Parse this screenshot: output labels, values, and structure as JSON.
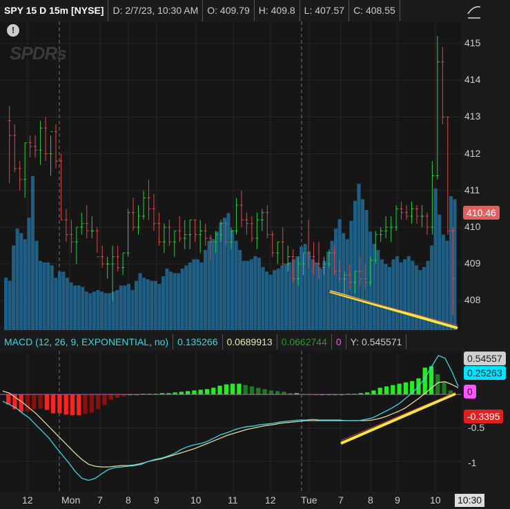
{
  "header": {
    "symbol": "SPY 15 D 15m [NYSE]",
    "date": "D: 2/7/23, 10:30 AM",
    "open": "O: 409.79",
    "high": "H: 409.8",
    "low": "L: 407.57",
    "close": "C: 408.55"
  },
  "watermark": "SPDRs",
  "price_axis": {
    "ticks": [
      "415",
      "414",
      "413",
      "412",
      "411",
      "410",
      "409",
      "408"
    ],
    "current_price": "410.46"
  },
  "macd": {
    "study": "MACD (12, 26, 9, EXPONENTIAL, no)",
    "value": "0.135266",
    "avg": "0.0689913",
    "diff": "0.0662744",
    "zeroline": "0",
    "cursor": "Y: 0.545571",
    "axis_ticks": [
      "-0.5",
      "-1"
    ],
    "label_max": "0.54557",
    "label_value": "0.25263",
    "label_zero": "0",
    "label_min": "-0.3395"
  },
  "time_axis": {
    "labels": [
      "12",
      "Mon",
      "7",
      "8",
      "9",
      "10",
      "11",
      "12",
      "Tue",
      "7",
      "8",
      "9",
      "10"
    ],
    "cursor_time": "10:30"
  },
  "colors": {
    "up_candle": "#2ecc40",
    "down_candle": "#e04848",
    "volume": "#1f5f86",
    "macd_line": "#3fd6e6",
    "avg_line": "#e8d8a0",
    "hist_pos_strong": "#22ee22",
    "hist_pos_weak": "#1e7a1e",
    "hist_neg_strong": "#ff2020",
    "hist_neg_weak": "#8a1010",
    "trendline": "#f5e642",
    "price_label_bg": "#e06060",
    "macd_label_bg": "#00e5ff",
    "max_label_bg": "#d0d0d0",
    "zero_label_bg": "#ff55ff",
    "min_label_bg": "#e02020"
  },
  "chart_data": {
    "type": "candlestick",
    "candles": [
      [
        412.9,
        413.3,
        411.2,
        412.5
      ],
      [
        412.5,
        412.8,
        411.5,
        411.6
      ],
      [
        411.6,
        411.8,
        411.0,
        411.3
      ],
      [
        411.3,
        412.3,
        410.8,
        412.3
      ],
      [
        412.3,
        412.5,
        411.9,
        412.2
      ],
      [
        412.2,
        412.5,
        411.9,
        412.1
      ],
      [
        412.1,
        412.9,
        411.7,
        412.7
      ],
      [
        412.7,
        413.0,
        411.8,
        412.0
      ],
      [
        412.0,
        412.5,
        411.4,
        412.6
      ],
      [
        412.6,
        412.8,
        411.6,
        411.8
      ],
      [
        411.8,
        412.0,
        410.2,
        410.2
      ],
      [
        410.2,
        410.5,
        409.6,
        409.8
      ],
      [
        409.8,
        410.2,
        409.3,
        409.6
      ],
      [
        409.6,
        410.0,
        409.0,
        410.0
      ],
      [
        410.0,
        410.4,
        409.8,
        410.1
      ],
      [
        410.1,
        410.6,
        409.7,
        409.9
      ],
      [
        409.9,
        410.3,
        409.7,
        409.9
      ],
      [
        409.9,
        410.0,
        409.3,
        409.2
      ],
      [
        409.2,
        409.5,
        408.9,
        409.0
      ],
      [
        409.0,
        409.2,
        408.6,
        409.0
      ],
      [
        409.0,
        409.5,
        408.0,
        409.2
      ],
      [
        409.2,
        409.5,
        408.8,
        408.9
      ],
      [
        408.9,
        409.3,
        408.7,
        409.3
      ],
      [
        409.3,
        410.5,
        409.2,
        410.4
      ],
      [
        410.4,
        410.8,
        409.9,
        410.0
      ],
      [
        410.0,
        410.6,
        409.8,
        410.3
      ],
      [
        410.3,
        411.0,
        410.2,
        410.8
      ],
      [
        410.8,
        411.3,
        410.2,
        410.5
      ],
      [
        410.5,
        410.9,
        409.9,
        410.1
      ],
      [
        410.1,
        410.4,
        409.5,
        409.6
      ],
      [
        409.6,
        410.1,
        409.3,
        410.0
      ],
      [
        410.0,
        410.2,
        409.5,
        409.6
      ],
      [
        409.6,
        409.9,
        409.2,
        409.9
      ],
      [
        409.9,
        410.3,
        409.6,
        409.7
      ],
      [
        409.7,
        410.2,
        409.4,
        409.8
      ],
      [
        409.8,
        410.2,
        409.4,
        410.2
      ],
      [
        410.2,
        410.2,
        409.6,
        409.8
      ],
      [
        409.8,
        410.2,
        409.3,
        409.9
      ],
      [
        409.9,
        410.1,
        409.5,
        409.7
      ],
      [
        409.7,
        409.8,
        409.1,
        409.6
      ],
      [
        409.6,
        409.9,
        409.3,
        409.8
      ],
      [
        409.8,
        410.2,
        409.6,
        410.1
      ],
      [
        410.1,
        410.2,
        409.5,
        409.6
      ],
      [
        409.6,
        410.0,
        409.4,
        409.9
      ],
      [
        409.9,
        410.8,
        409.8,
        410.6
      ],
      [
        410.6,
        411.0,
        410.0,
        410.2
      ],
      [
        410.2,
        410.4,
        409.8,
        410.1
      ],
      [
        410.1,
        410.3,
        409.6,
        409.7
      ],
      [
        409.7,
        410.4,
        409.4,
        410.2
      ],
      [
        410.2,
        410.5,
        409.9,
        410.4
      ],
      [
        410.4,
        410.6,
        409.7,
        409.8
      ],
      [
        409.8,
        409.9,
        409.2,
        409.3
      ],
      [
        409.3,
        409.6,
        409.0,
        409.6
      ],
      [
        409.6,
        410.0,
        408.9,
        409.0
      ],
      [
        409.0,
        409.5,
        408.8,
        409.2
      ],
      [
        409.2,
        409.4,
        408.5,
        408.6
      ],
      [
        408.6,
        409.2,
        408.4,
        409.0
      ],
      [
        409.0,
        409.3,
        408.7,
        409.3
      ],
      [
        409.3,
        410.2,
        408.9,
        409.2
      ],
      [
        409.2,
        409.6,
        408.7,
        409.0
      ],
      [
        409.0,
        409.6,
        408.6,
        408.9
      ],
      [
        408.9,
        409.2,
        408.7,
        409.0
      ],
      [
        409.0,
        409.4,
        408.9,
        409.3
      ],
      [
        409.3,
        409.5,
        408.7,
        408.8
      ],
      [
        408.8,
        409.1,
        408.5,
        408.6
      ],
      [
        408.6,
        408.8,
        408.1,
        408.7
      ],
      [
        408.7,
        409.0,
        408.3,
        408.5
      ],
      [
        408.5,
        408.8,
        408.2,
        408.8
      ],
      [
        408.8,
        409.2,
        408.4,
        408.6
      ],
      [
        408.6,
        409.0,
        408.3,
        408.5
      ],
      [
        408.5,
        409.2,
        408.4,
        409.1
      ],
      [
        409.1,
        409.9,
        409.0,
        409.8
      ],
      [
        409.8,
        410.0,
        409.6,
        409.9
      ],
      [
        409.9,
        410.3,
        409.7,
        410.0
      ],
      [
        410.0,
        410.3,
        409.6,
        410.0
      ],
      [
        410.0,
        410.6,
        409.9,
        410.5
      ],
      [
        410.5,
        410.7,
        410.2,
        410.4
      ],
      [
        410.4,
        410.6,
        410.2,
        410.3
      ],
      [
        410.3,
        410.7,
        410.1,
        410.5
      ],
      [
        410.5,
        410.6,
        410.1,
        410.3
      ],
      [
        410.3,
        410.6,
        410.0,
        410.3
      ],
      [
        410.3,
        410.4,
        409.8,
        410.0
      ],
      [
        410.0,
        411.8,
        409.8,
        411.4
      ],
      [
        411.4,
        415.2,
        411.3,
        414.5
      ],
      [
        414.5,
        414.9,
        412.8,
        413.0
      ],
      [
        413.0,
        413.0,
        409.8,
        409.9
      ],
      [
        409.9,
        410.0,
        407.6,
        408.6
      ]
    ],
    "volume": [
      0.34,
      0.32,
      0.55,
      0.66,
      0.63,
      0.59,
      0.73,
      1.0,
      0.58,
      0.45,
      0.44,
      0.44,
      0.42,
      0.34,
      0.38,
      0.38,
      0.34,
      0.31,
      0.29,
      0.29,
      0.28,
      0.25,
      0.24,
      0.25,
      0.26,
      0.25,
      0.24,
      0.24,
      0.25,
      0.26,
      0.29,
      0.29,
      0.3,
      0.26,
      0.32,
      0.37,
      0.34,
      0.33,
      0.32,
      0.32,
      0.3,
      0.35,
      0.4,
      0.38,
      0.37,
      0.37,
      0.4,
      0.42,
      0.44,
      0.46,
      0.46,
      0.44,
      0.52,
      0.58,
      0.59,
      0.64,
      0.7,
      0.73,
      0.76,
      0.65,
      0.58,
      0.52,
      0.45,
      0.45,
      0.46,
      0.48,
      0.47,
      0.41,
      0.38,
      0.36,
      0.39,
      0.4,
      0.42,
      0.43,
      0.44,
      0.46,
      0.48,
      0.54,
      0.56,
      0.51,
      0.46,
      0.44,
      0.4,
      0.45,
      0.51,
      0.58,
      0.66,
      0.72,
      0.63,
      0.59,
      0.71,
      0.84,
      0.95,
      0.85,
      0.78,
      0.64,
      0.56,
      0.52,
      0.46,
      0.43,
      0.41,
      0.46,
      0.48,
      0.44,
      0.46,
      0.48,
      0.45,
      0.42,
      0.39,
      0.41,
      0.45,
      0.55,
      0.92,
      0.75,
      0.62,
      0.58,
      0.87,
      0.85
    ],
    "macd_line": [
      -0.1,
      -0.15,
      -0.2,
      -0.28,
      -0.35,
      -0.45,
      -0.55,
      -0.65,
      -0.78,
      -0.9,
      -1.02,
      -1.15,
      -1.25,
      -1.28,
      -1.25,
      -1.18,
      -1.12,
      -1.09,
      -1.08,
      -1.07,
      -1.06,
      -1.04,
      -1.0,
      -0.97,
      -0.95,
      -0.92,
      -0.88,
      -0.82,
      -0.78,
      -0.75,
      -0.73,
      -0.7,
      -0.65,
      -0.6,
      -0.57,
      -0.53,
      -0.5,
      -0.48,
      -0.47,
      -0.45,
      -0.44,
      -0.43,
      -0.41,
      -0.4,
      -0.39,
      -0.38,
      -0.38,
      -0.37,
      -0.38,
      -0.38,
      -0.38,
      -0.38,
      -0.39,
      -0.39,
      -0.39,
      -0.37,
      -0.35,
      -0.3,
      -0.25,
      -0.2,
      -0.14,
      -0.06,
      0.02,
      0.12,
      0.25,
      0.42,
      0.58,
      0.54,
      0.35,
      0.12
    ],
    "avg_line": [
      0.05,
      0.02,
      -0.05,
      -0.12,
      -0.2,
      -0.28,
      -0.38,
      -0.48,
      -0.58,
      -0.68,
      -0.78,
      -0.88,
      -0.97,
      -1.04,
      -1.07,
      -1.08,
      -1.08,
      -1.07,
      -1.06,
      -1.06,
      -1.05,
      -1.03,
      -1.0,
      -0.98,
      -0.96,
      -0.93,
      -0.9,
      -0.87,
      -0.84,
      -0.81,
      -0.77,
      -0.73,
      -0.69,
      -0.65,
      -0.61,
      -0.58,
      -0.55,
      -0.52,
      -0.5,
      -0.48,
      -0.46,
      -0.45,
      -0.43,
      -0.42,
      -0.41,
      -0.4,
      -0.39,
      -0.39,
      -0.39,
      -0.39,
      -0.39,
      -0.39,
      -0.39,
      -0.39,
      -0.39,
      -0.39,
      -0.38,
      -0.36,
      -0.33,
      -0.29,
      -0.25,
      -0.2,
      -0.13,
      -0.06,
      0.02,
      0.1,
      0.18,
      0.19,
      0.15,
      0.1
    ],
    "histogram": [
      -0.15,
      -0.22,
      -0.26,
      -0.25,
      -0.22,
      -0.21,
      -0.23,
      -0.28,
      -0.28,
      -0.3,
      -0.31,
      -0.31,
      -0.29,
      -0.27,
      -0.22,
      -0.16,
      -0.08,
      -0.05,
      -0.03,
      0.0,
      0.0,
      0.01,
      0.01,
      0.01,
      0.02,
      0.02,
      0.03,
      0.04,
      0.05,
      0.06,
      0.07,
      0.08,
      0.1,
      0.13,
      0.15,
      0.16,
      0.16,
      0.14,
      0.12,
      0.1,
      0.08,
      0.06,
      0.05,
      0.04,
      0.02,
      0.02,
      0.01,
      0.0,
      -0.01,
      0.0,
      0.0,
      0.0,
      0.0,
      0.01,
      0.01,
      0.02,
      0.03,
      0.06,
      0.1,
      0.12,
      0.14,
      0.16,
      0.18,
      0.2,
      0.24,
      0.4,
      0.42,
      0.3,
      0.18,
      0.06
    ],
    "trendlines": [
      {
        "panel": "price",
        "from": {
          "x": "Tue 7",
          "y": 408.3
        },
        "to": {
          "x": "10:30",
          "y": 407.7
        }
      },
      {
        "panel": "macd",
        "from": {
          "x": "Tue 7",
          "y": -0.62
        },
        "to": {
          "x": "10:30",
          "y": 0.0
        }
      }
    ]
  }
}
